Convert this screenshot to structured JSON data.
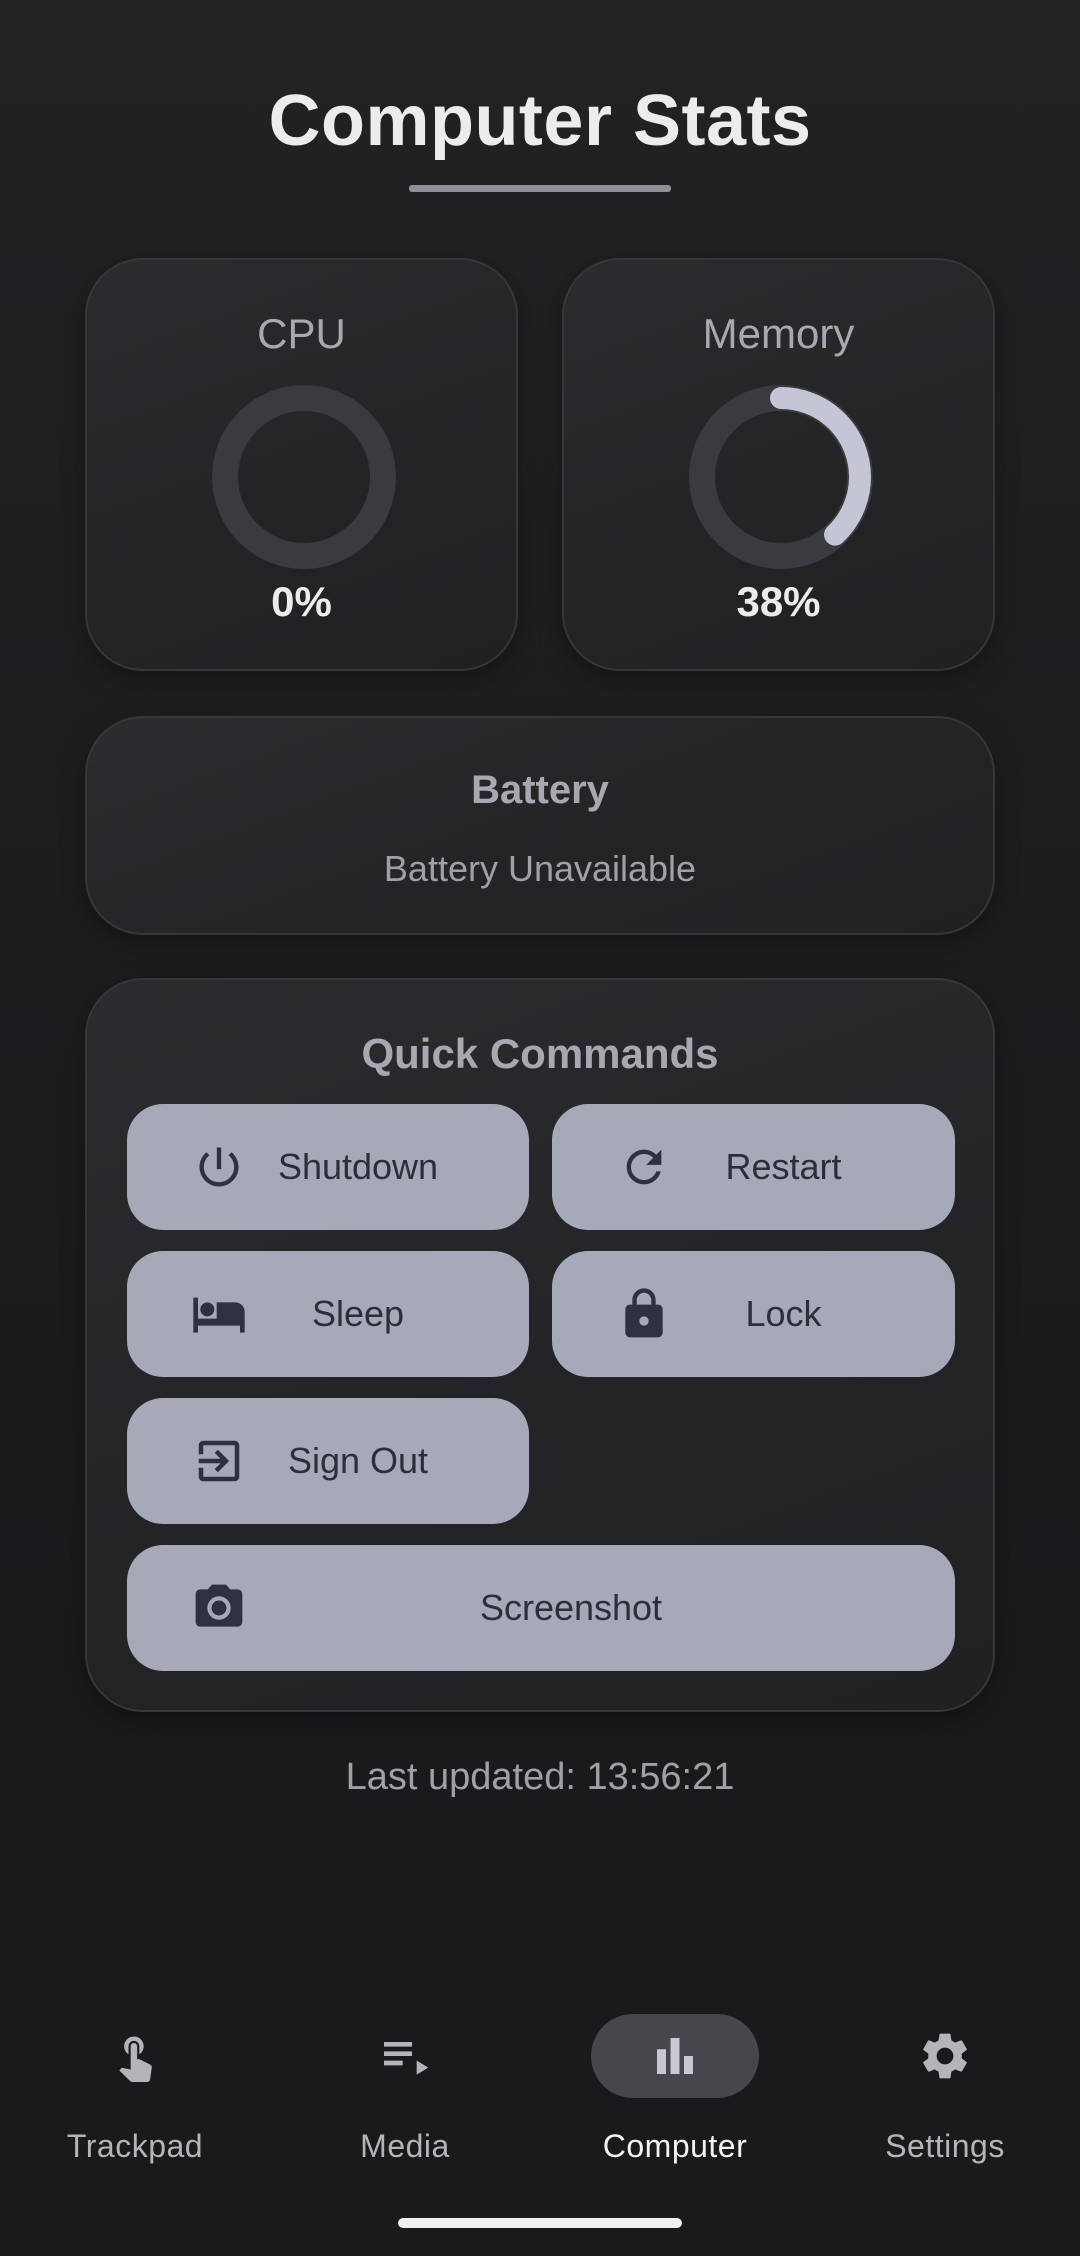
{
  "header": {
    "title": "Computer Stats"
  },
  "stats": {
    "cpu": {
      "label": "CPU",
      "value_text": "0%",
      "percent": 0
    },
    "memory": {
      "label": "Memory",
      "value_text": "38%",
      "percent": 38
    }
  },
  "battery": {
    "title": "Battery",
    "status": "Battery Unavailable"
  },
  "quick_commands": {
    "title": "Quick Commands",
    "buttons": [
      {
        "label": "Shutdown",
        "icon": "power-icon"
      },
      {
        "label": "Restart",
        "icon": "refresh-icon"
      },
      {
        "label": "Sleep",
        "icon": "bed-icon"
      },
      {
        "label": "Lock",
        "icon": "lock-icon"
      },
      {
        "label": "Sign Out",
        "icon": "exit-icon"
      },
      {
        "label": "Screenshot",
        "icon": "camera-icon"
      }
    ]
  },
  "footer": {
    "last_updated": "Last updated: 13:56:21"
  },
  "nav": {
    "items": [
      {
        "label": "Trackpad",
        "icon": "touch-icon",
        "active": false
      },
      {
        "label": "Media",
        "icon": "playlist-icon",
        "active": false
      },
      {
        "label": "Computer",
        "icon": "bar-chart-icon",
        "active": true
      },
      {
        "label": "Settings",
        "icon": "gear-icon",
        "active": false
      }
    ]
  },
  "colors": {
    "background": "#1c1c1f",
    "card": "#262629",
    "button": "#a6a9b8",
    "button_text": "#2c2e38",
    "gauge_track": "#3a3a40",
    "gauge_fill": "#c4c6d6",
    "nav_active_pill": "#46474d"
  }
}
